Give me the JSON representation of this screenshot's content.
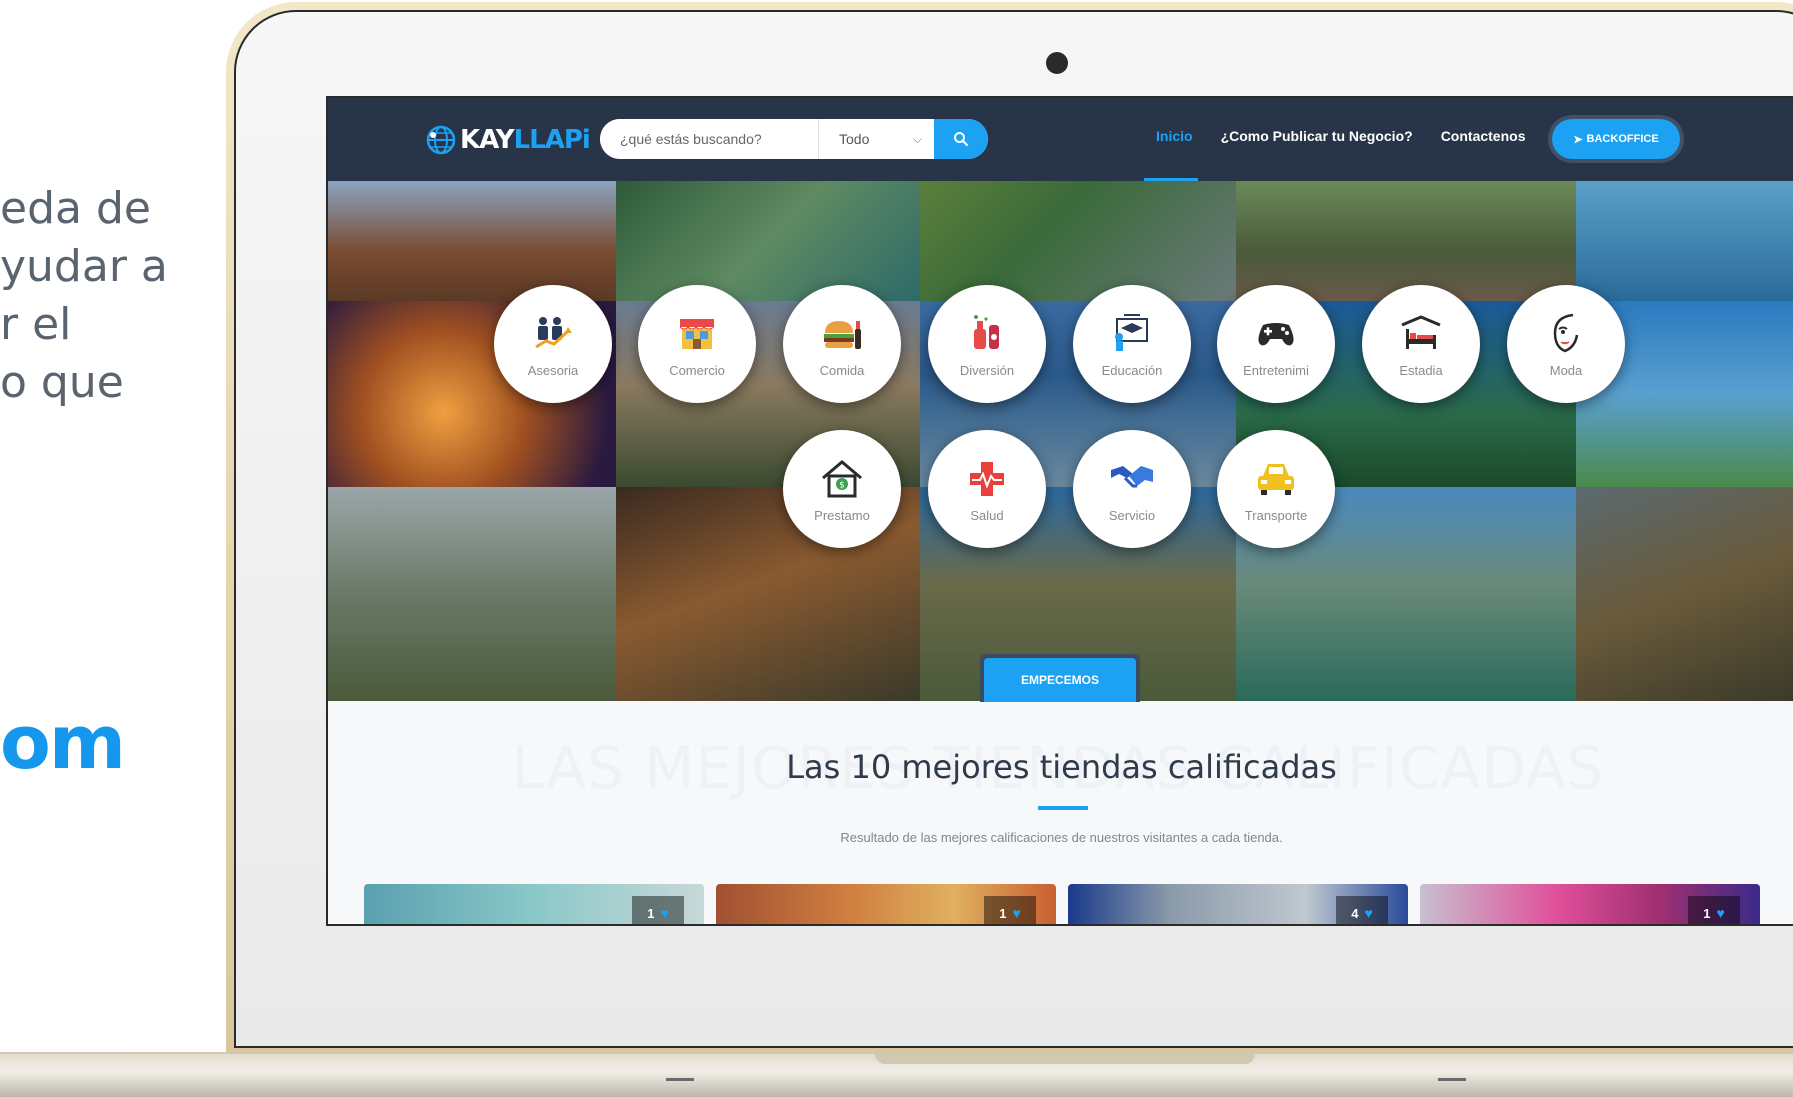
{
  "left_text": {
    "lines": [
      "eda de",
      "yudar a",
      "r el",
      "o que"
    ],
    "brand": "om"
  },
  "navbar": {
    "logo": {
      "text_main": "KAY",
      "text_accent": "LLAPi"
    },
    "search": {
      "placeholder": "¿qué estás buscando?",
      "select_value": "Todo"
    },
    "links": [
      {
        "label": "Inicio",
        "active": true
      },
      {
        "label": "¿Como Publicar tu Negocio?",
        "active": false
      },
      {
        "label": "Contactenos",
        "active": false
      }
    ],
    "backoffice_label": "BACKOFFICE"
  },
  "categories": [
    {
      "label": "Asesoria",
      "icon": "business-people-icon"
    },
    {
      "label": "Comercio",
      "icon": "store-icon"
    },
    {
      "label": "Comida",
      "icon": "burger-icon"
    },
    {
      "label": "Diversión",
      "icon": "drinks-icon"
    },
    {
      "label": "Educación",
      "icon": "graduation-icon"
    },
    {
      "label": "Entretenimi",
      "icon": "gamepad-icon"
    },
    {
      "label": "Estadia",
      "icon": "bed-icon"
    },
    {
      "label": "Moda",
      "icon": "face-icon"
    },
    {
      "label": "Prestamo",
      "icon": "money-house-icon"
    },
    {
      "label": "Salud",
      "icon": "health-cross-icon"
    },
    {
      "label": "Servicio",
      "icon": "handshake-icon"
    },
    {
      "label": "Transporte",
      "icon": "car-icon"
    }
  ],
  "cta_label": "EMPECEMOS",
  "section": {
    "bg_title": "LAS MEJORES TIENDAS CALIFICADAS",
    "title": "Las 10 mejores tiendas calificadas",
    "subtitle": "Resultado de las mejores calificaciones de nuestros visitantes a cada tienda."
  },
  "stores": [
    {
      "likes": "1"
    },
    {
      "likes": "1"
    },
    {
      "likes": "4"
    },
    {
      "likes": "1"
    }
  ]
}
